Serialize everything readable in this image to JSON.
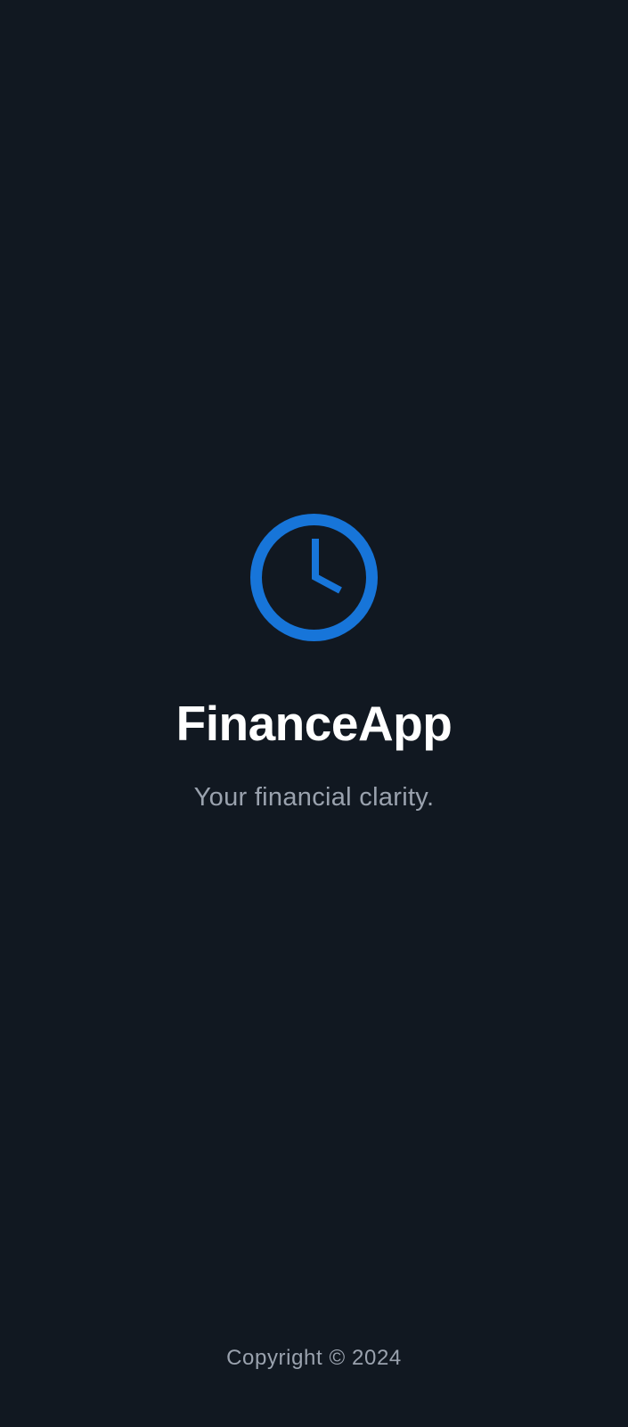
{
  "splash": {
    "logo_icon": "clock-icon",
    "app_name": "FinanceApp",
    "tagline": "Your financial clarity.",
    "copyright": "Copyright © 2024"
  },
  "colors": {
    "background": "#111821",
    "accent": "#1775d9",
    "title": "#ffffff",
    "muted_text": "#9aa2ae"
  }
}
